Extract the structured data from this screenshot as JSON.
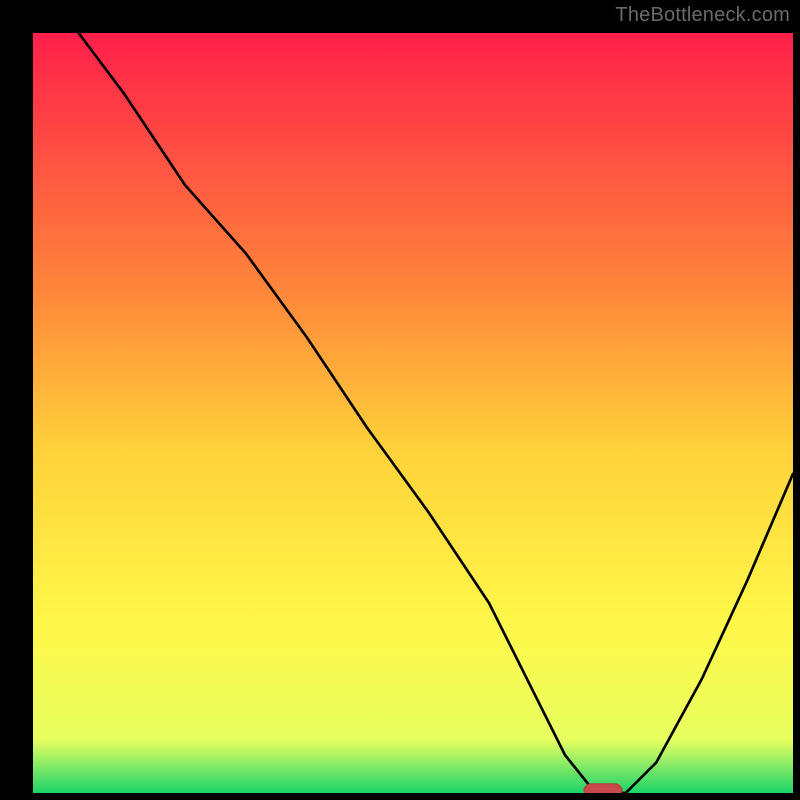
{
  "watermark": "TheBottleneck.com",
  "colors": {
    "frame": "#000000",
    "grad_top": "#ff1f4a",
    "grad_mid1": "#ff8a3a",
    "grad_mid2": "#ffd23a",
    "grad_mid3": "#fff84a",
    "grad_mid4": "#e8ff60",
    "grad_bottom": "#1bd36a",
    "curve": "#000000",
    "marker_fill": "#c94a4c",
    "marker_stroke": "#b33d3f"
  },
  "chart_data": {
    "type": "line",
    "title": "",
    "xlabel": "",
    "ylabel": "",
    "xlim": [
      0,
      100
    ],
    "ylim": [
      0,
      100
    ],
    "series": [
      {
        "name": "bottleneck-curve",
        "x": [
          6,
          12,
          20,
          28,
          36,
          44,
          52,
          60,
          66,
          70,
          74,
          78,
          82,
          88,
          94,
          100
        ],
        "values": [
          100,
          92,
          80,
          71,
          60,
          48,
          37,
          25,
          13,
          5,
          0,
          0,
          4,
          15,
          28,
          42
        ]
      }
    ],
    "marker": {
      "x": 75,
      "y": 0,
      "rx": 2.5,
      "ry": 1.2
    }
  }
}
